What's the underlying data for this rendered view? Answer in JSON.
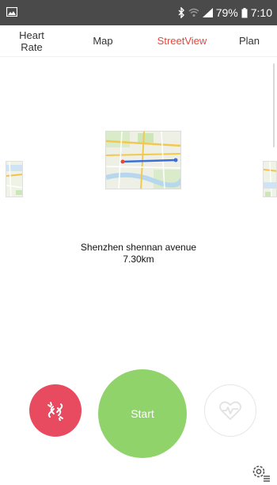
{
  "status_bar": {
    "bluetooth_icon": "bluetooth-icon",
    "wifi_icon": "wifi-icon",
    "signal_icon": "signal-icon",
    "battery_percent": "79%",
    "battery_icon": "battery-icon",
    "time": "7:10"
  },
  "tabs": [
    {
      "label": "HeartRate",
      "active": false
    },
    {
      "label": "Map",
      "active": false
    },
    {
      "label": "StreetView",
      "active": true
    },
    {
      "label": "Plan",
      "active": false
    }
  ],
  "route": {
    "name": "Shenzhen shennan avenue",
    "distance": "7.30km"
  },
  "controls": {
    "start_label": "Start",
    "link_icon": "broken-link-icon",
    "heart_icon": "heart-rate-icon",
    "settings_icon": "settings-list-icon"
  },
  "colors": {
    "active_tab": "#e8463a",
    "link_button": "#e84a5f",
    "start_button": "#8fd36a",
    "status_bar": "#4a4a4a"
  }
}
